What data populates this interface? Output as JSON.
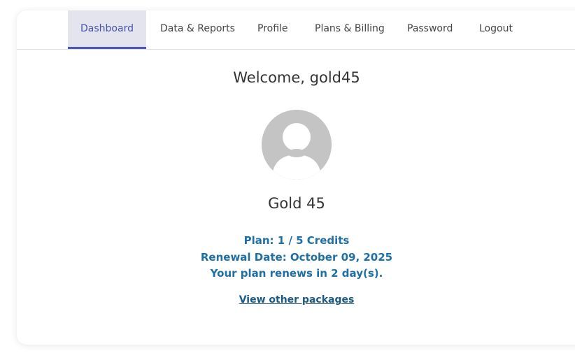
{
  "nav": {
    "tabs": [
      {
        "label": "Dashboard",
        "active": true
      },
      {
        "label": "Data & Reports",
        "active": false
      },
      {
        "label": "Profile",
        "active": false
      },
      {
        "label": "Plans & Billing",
        "active": false
      },
      {
        "label": "Password",
        "active": false
      },
      {
        "label": "Logout",
        "active": false
      }
    ]
  },
  "main": {
    "welcome": "Welcome, gold45",
    "avatar_icon": "default-user-avatar-icon",
    "display_name": "Gold 45",
    "plan": {
      "plan_line": "Plan: 1 / 5 Credits",
      "renewal_line": "Renewal Date: October 09, 2025",
      "renews_in_line": "Your plan renews in 2 day(s)."
    },
    "packages_link": "View other packages"
  },
  "colors": {
    "accent": "#4a56b0",
    "active_tab_bg": "#e3e4ee",
    "plan_text": "#1e6fa6",
    "link": "#1a5a85",
    "avatar_gray": "#c4c4c4"
  }
}
